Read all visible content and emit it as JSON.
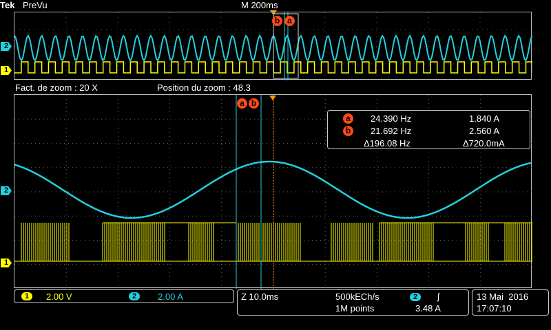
{
  "header": {
    "logo": "Tek",
    "mode": "PreVu",
    "timebase": "M 200ms"
  },
  "zoom": {
    "factor": "Fact. de zoom : 20 X",
    "position": "Position du zoom  : 48.3"
  },
  "markers": {
    "ch1": "1",
    "ch2": "2",
    "cursor_a": "a",
    "cursor_b": "b"
  },
  "readout": {
    "a_freq": "24.390 Hz",
    "a_value": "1.840 A",
    "b_freq": "21.692 Hz",
    "b_value": "2.560 A",
    "delta_freq": "Δ196.08 Hz",
    "delta_value": "Δ720.0mA"
  },
  "bottom": {
    "ch1_num": "1",
    "ch1_scale": "2.00 V",
    "ch2_num": "2",
    "ch2_scale": "2.00 A",
    "zoom_scale": "Z 10.0ms",
    "sample_rate": "500kECh/s",
    "record_length": "1M points",
    "trigger_source": "2",
    "trigger_slope": "ʃ",
    "trigger_level": "3.48 A",
    "date": "13 Mai  2016",
    "time": "17:07:10"
  },
  "colors": {
    "ch1": "#ffff00",
    "ch2": "#22d0dd",
    "cursor": "#ff4a1a",
    "trigger": "#ff9a00"
  }
}
